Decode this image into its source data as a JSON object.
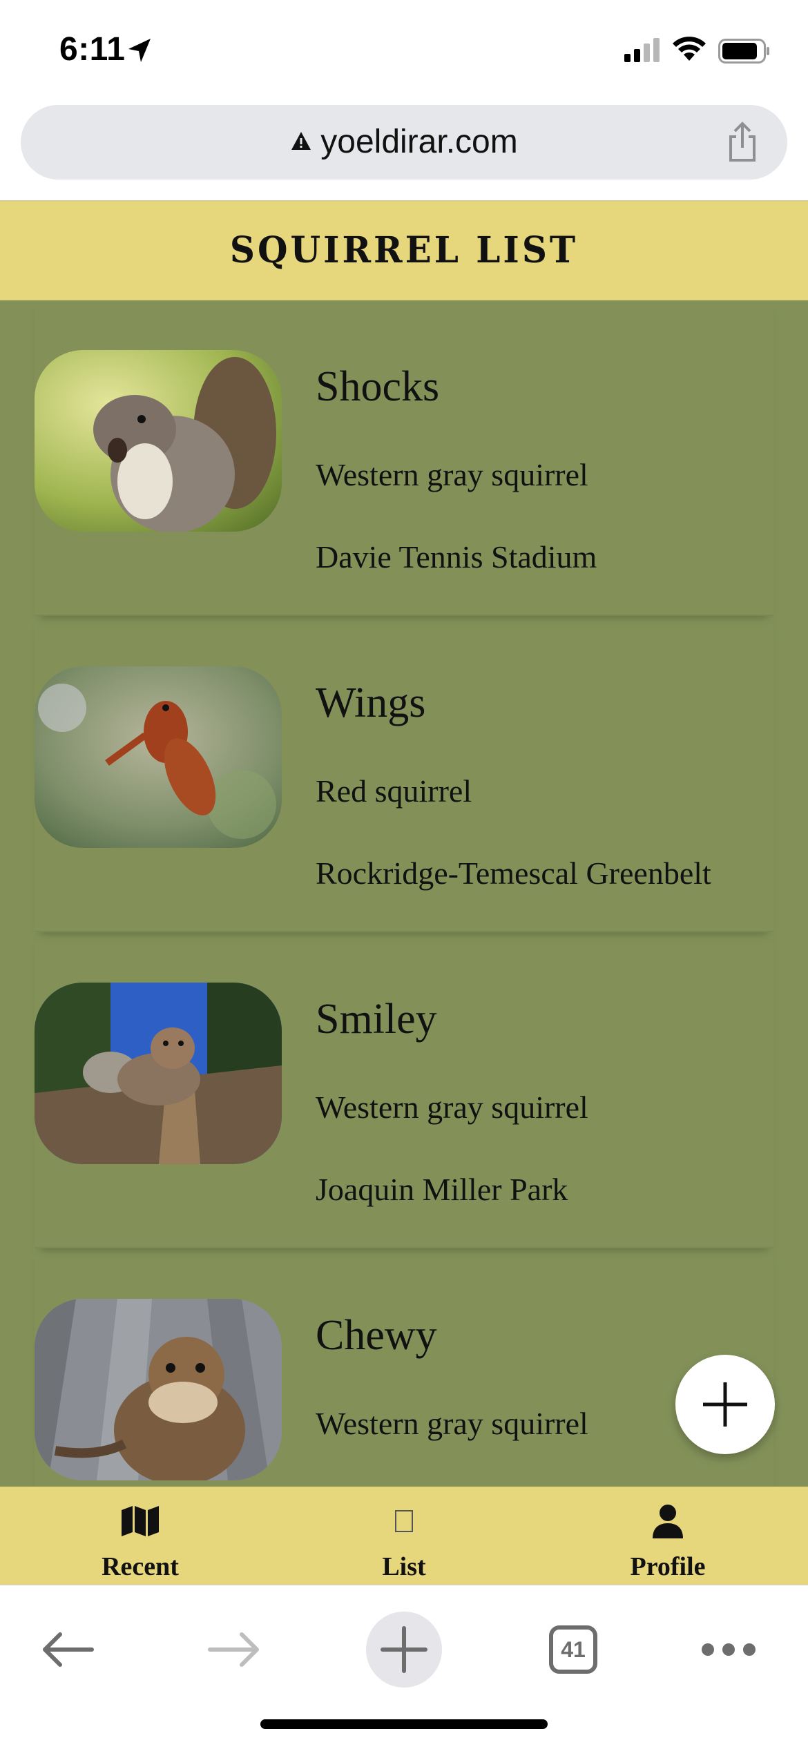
{
  "status_bar": {
    "time": "6:11"
  },
  "browser": {
    "url": "yoeldirar.com",
    "tab_count": "41"
  },
  "app": {
    "title": "SQUIRREL LIST",
    "colors": {
      "header": "#e6d77d",
      "content": "#839159"
    }
  },
  "squirrels": [
    {
      "name": "Shocks",
      "species": "Western gray squirrel",
      "location": "Davie Tennis Stadium"
    },
    {
      "name": "Wings",
      "species": "Red squirrel",
      "location": "Rockridge-Temescal Greenbelt"
    },
    {
      "name": "Smiley",
      "species": "Western gray squirrel",
      "location": "Joaquin Miller Park"
    },
    {
      "name": "Chewy",
      "species": "Western gray squirrel",
      "location": ""
    }
  ],
  "nav": {
    "items": [
      {
        "label": "Recent",
        "icon": "map-icon"
      },
      {
        "label": "List",
        "icon": "list-icon"
      },
      {
        "label": "Profile",
        "icon": "person-icon"
      }
    ]
  },
  "fab": {
    "icon": "plus-icon"
  }
}
